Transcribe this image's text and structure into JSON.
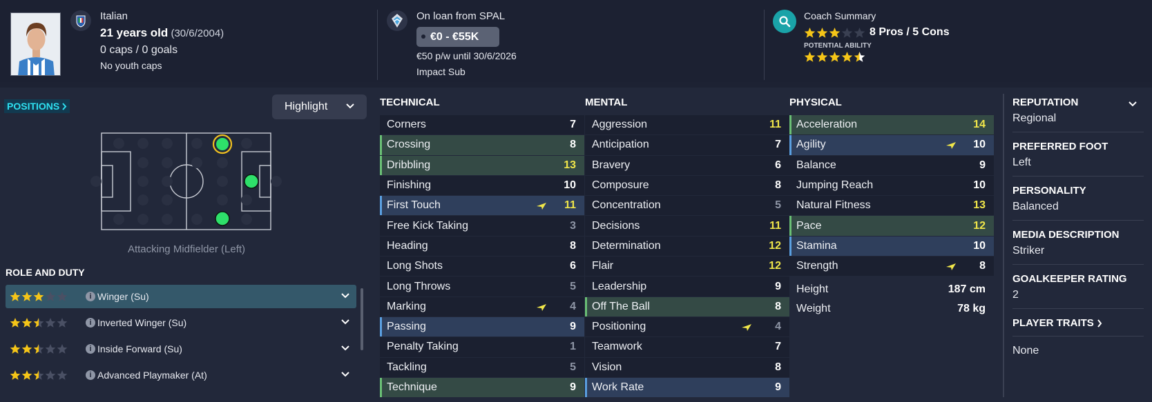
{
  "header": {
    "nationality": "Italian",
    "age": "21 years old",
    "dob": "(30/6/2004)",
    "caps": "0 caps / 0 goals",
    "youth_caps": "No youth caps",
    "loan": "On loan from SPAL",
    "wage_range": "€0 - €55K",
    "contract": "€50 p/w until 30/6/2026",
    "squad_status": "Impact Sub",
    "coach_title": "Coach Summary",
    "pros_cons": "8 Pros / 5 Cons",
    "potential_label": "POTENTIAL ABILITY",
    "current_ability_stars": 3,
    "potential_ability_stars": 4.5,
    "star_color": "#f5c518"
  },
  "positions": {
    "link_label": "POSITIONS",
    "highlight_label": "Highlight",
    "position_name": "Attacking Midfielder (Left)"
  },
  "role_duty": {
    "title": "ROLE AND DUTY",
    "roles": [
      {
        "name": "Winger (Su)",
        "stars": 3,
        "active": true
      },
      {
        "name": "Inverted Winger (Su)",
        "stars": 2.5,
        "active": false
      },
      {
        "name": "Inside Forward (Su)",
        "stars": 2.5,
        "active": false
      },
      {
        "name": "Advanced Playmaker (At)",
        "stars": 2.5,
        "active": false
      }
    ]
  },
  "technical": {
    "title": "TECHNICAL",
    "rows": [
      {
        "name": "Corners",
        "value": "7",
        "hl": "",
        "tone": "white",
        "arrow": false
      },
      {
        "name": "Crossing",
        "value": "8",
        "hl": "g",
        "tone": "white",
        "arrow": false
      },
      {
        "name": "Dribbling",
        "value": "13",
        "hl": "g",
        "tone": "yellow",
        "arrow": false
      },
      {
        "name": "Finishing",
        "value": "10",
        "hl": "",
        "tone": "white",
        "arrow": false
      },
      {
        "name": "First Touch",
        "value": "11",
        "hl": "b",
        "tone": "yellow",
        "arrow": true
      },
      {
        "name": "Free Kick Taking",
        "value": "3",
        "hl": "",
        "tone": "grey",
        "arrow": false
      },
      {
        "name": "Heading",
        "value": "8",
        "hl": "",
        "tone": "white",
        "arrow": false
      },
      {
        "name": "Long Shots",
        "value": "6",
        "hl": "",
        "tone": "white",
        "arrow": false
      },
      {
        "name": "Long Throws",
        "value": "5",
        "hl": "",
        "tone": "grey",
        "arrow": false
      },
      {
        "name": "Marking",
        "value": "4",
        "hl": "",
        "tone": "grey",
        "arrow": true
      },
      {
        "name": "Passing",
        "value": "9",
        "hl": "b",
        "tone": "white",
        "arrow": false
      },
      {
        "name": "Penalty Taking",
        "value": "1",
        "hl": "",
        "tone": "grey",
        "arrow": false
      },
      {
        "name": "Tackling",
        "value": "5",
        "hl": "",
        "tone": "grey",
        "arrow": false
      },
      {
        "name": "Technique",
        "value": "9",
        "hl": "g",
        "tone": "white",
        "arrow": false
      }
    ]
  },
  "mental": {
    "title": "MENTAL",
    "rows": [
      {
        "name": "Aggression",
        "value": "11",
        "hl": "",
        "tone": "yellow",
        "arrow": false
      },
      {
        "name": "Anticipation",
        "value": "7",
        "hl": "",
        "tone": "white",
        "arrow": false
      },
      {
        "name": "Bravery",
        "value": "6",
        "hl": "",
        "tone": "white",
        "arrow": false
      },
      {
        "name": "Composure",
        "value": "8",
        "hl": "",
        "tone": "white",
        "arrow": false
      },
      {
        "name": "Concentration",
        "value": "5",
        "hl": "",
        "tone": "grey",
        "arrow": false
      },
      {
        "name": "Decisions",
        "value": "11",
        "hl": "",
        "tone": "yellow",
        "arrow": false
      },
      {
        "name": "Determination",
        "value": "12",
        "hl": "",
        "tone": "yellow",
        "arrow": false
      },
      {
        "name": "Flair",
        "value": "12",
        "hl": "",
        "tone": "yellow",
        "arrow": false
      },
      {
        "name": "Leadership",
        "value": "9",
        "hl": "",
        "tone": "white",
        "arrow": false
      },
      {
        "name": "Off The Ball",
        "value": "8",
        "hl": "g",
        "tone": "white",
        "arrow": false
      },
      {
        "name": "Positioning",
        "value": "4",
        "hl": "",
        "tone": "grey",
        "arrow": true
      },
      {
        "name": "Teamwork",
        "value": "7",
        "hl": "",
        "tone": "white",
        "arrow": false
      },
      {
        "name": "Vision",
        "value": "8",
        "hl": "",
        "tone": "white",
        "arrow": false
      },
      {
        "name": "Work Rate",
        "value": "9",
        "hl": "b",
        "tone": "white",
        "arrow": false
      }
    ]
  },
  "physical": {
    "title": "PHYSICAL",
    "rows": [
      {
        "name": "Acceleration",
        "value": "14",
        "hl": "g",
        "tone": "yellow",
        "arrow": false
      },
      {
        "name": "Agility",
        "value": "10",
        "hl": "b",
        "tone": "white",
        "arrow": true
      },
      {
        "name": "Balance",
        "value": "9",
        "hl": "",
        "tone": "white",
        "arrow": false
      },
      {
        "name": "Jumping Reach",
        "value": "10",
        "hl": "",
        "tone": "white",
        "arrow": false
      },
      {
        "name": "Natural Fitness",
        "value": "13",
        "hl": "",
        "tone": "yellow",
        "arrow": false
      },
      {
        "name": "Pace",
        "value": "12",
        "hl": "g",
        "tone": "yellow",
        "arrow": false
      },
      {
        "name": "Stamina",
        "value": "10",
        "hl": "b",
        "tone": "white",
        "arrow": false
      },
      {
        "name": "Strength",
        "value": "8",
        "hl": "",
        "tone": "white",
        "arrow": true
      }
    ],
    "height_label": "Height",
    "height_value": "187 cm",
    "weight_label": "Weight",
    "weight_value": "78 kg"
  },
  "info": {
    "reputation_label": "REPUTATION",
    "reputation_value": "Regional",
    "foot_label": "PREFERRED FOOT",
    "foot_value": "Left",
    "personality_label": "PERSONALITY",
    "personality_value": "Balanced",
    "media_label": "MEDIA DESCRIPTION",
    "media_value": "Striker",
    "gk_label": "GOALKEEPER RATING",
    "gk_value": "2",
    "traits_label": "PLAYER TRAITS",
    "traits_value": "None"
  },
  "icons": {
    "flag": "italy-federation-icon",
    "club": "spal-crest-icon",
    "search": "search-icon",
    "arrow": "development-arrow-icon"
  }
}
